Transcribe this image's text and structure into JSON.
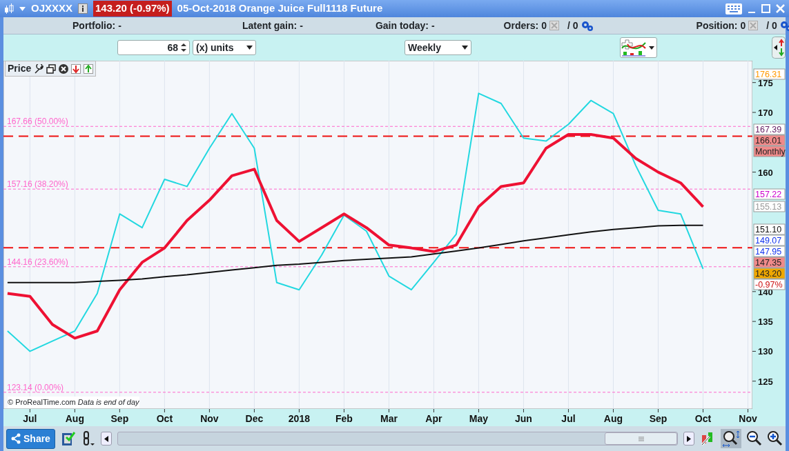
{
  "title_bar": {
    "instrument": "OJXXXX",
    "price_badge": "143.20 (-0.97%)",
    "description": "05-Oct-2018 Orange Juice Full1118 Future"
  },
  "info_bar": [
    {
      "kind": "plain",
      "label": "Portfolio:",
      "value": "-"
    },
    {
      "kind": "plain",
      "label": "Latent gain:",
      "value": "-"
    },
    {
      "kind": "plain",
      "label": "Gain today:",
      "value": "-"
    },
    {
      "kind": "counts",
      "label": "Orders:",
      "value": "0",
      "second": "/ 0"
    },
    {
      "kind": "counts",
      "label": "Position:",
      "value": "0",
      "second": "/ 0"
    }
  ],
  "toolbar": {
    "quantity": "68",
    "units": "(x) units",
    "period": "Weekly"
  },
  "panel": {
    "title": "Price"
  },
  "chart": {
    "chart_data": {
      "type": "line",
      "categories": [
        null,
        "Jul",
        null,
        "Aug",
        null,
        "Sep",
        null,
        "Oct",
        null,
        "Nov",
        null,
        "Dec",
        null,
        "2018",
        null,
        "Feb",
        null,
        "Mar",
        null,
        "Apr",
        null,
        "May",
        null,
        "Jun",
        null,
        "Jul",
        null,
        "Aug",
        null,
        "Sep",
        null,
        "Oct",
        null,
        "Nov",
        null
      ],
      "series": [
        {
          "color": "#22d8e0",
          "values": [
            133.4,
            130,
            131.7,
            133.4,
            139.7,
            153,
            150.7,
            158.8,
            157.6,
            164,
            169.8,
            164,
            141.5,
            140.3,
            146.1,
            152.8,
            150.1,
            142.6,
            140.3,
            144.9,
            149.6,
            173.2,
            171.5,
            165.7,
            165.2,
            168,
            172,
            169.8,
            161.1,
            153.6,
            153,
            143.8,
            null,
            null,
            null
          ]
        },
        {
          "color": "#ee1133",
          "values": [
            139.7,
            139.2,
            134.5,
            132.2,
            133.4,
            140.3,
            144.9,
            147.3,
            151.9,
            155.3,
            159.4,
            160.5,
            151.9,
            148.4,
            150.7,
            153,
            150.7,
            147.8,
            147.3,
            146.7,
            147.8,
            154.2,
            157.6,
            158.2,
            164,
            166.3,
            166.3,
            165.7,
            162.3,
            160,
            158.2,
            154.2,
            null,
            null,
            null
          ]
        },
        {
          "color": "#111111",
          "values": [
            141.5,
            141.5,
            141.5,
            141.5,
            141.7,
            141.9,
            142.1,
            142.5,
            142.8,
            143.2,
            143.6,
            144,
            144.4,
            144.6,
            144.9,
            145.2,
            145.4,
            145.6,
            145.8,
            146.3,
            146.8,
            147.3,
            147.9,
            148.5,
            149,
            149.5,
            150,
            150.4,
            150.7,
            151,
            151.1,
            151.1,
            null,
            null,
            null
          ]
        }
      ],
      "ylim": [
        120.35,
        178.66
      ],
      "yticks": [
        125,
        130,
        135,
        140,
        160,
        170,
        175
      ],
      "grid": true,
      "ref_lines": [
        {
          "axis": "y",
          "value": 167.66,
          "label": "167.66 (50.00%)",
          "color": "#ff66cc"
        },
        {
          "axis": "y",
          "value": 157.16,
          "label": "157.16 (38.20%)",
          "color": "#ff66cc"
        },
        {
          "axis": "y",
          "value": 144.16,
          "label": "144.16 (23.60%)",
          "color": "#ff66cc"
        },
        {
          "axis": "y",
          "value": 123.14,
          "label": "123.14 (0.00%)",
          "color": "#ff66cc"
        },
        {
          "axis": "y",
          "value": 166.01,
          "color": "#ee1111"
        },
        {
          "axis": "y",
          "value": 147.35,
          "color": "#ee1111"
        }
      ]
    },
    "price_tags": [
      {
        "text": "176.31",
        "color": "#ff9900",
        "filled": false
      },
      {
        "text": "167.39",
        "color": "#662266",
        "filled": false
      },
      {
        "text": "166.01",
        "color": "#f08a8a",
        "filled": true
      },
      {
        "text": "Monthly",
        "color": "#f08a8a",
        "filled": true
      },
      {
        "text": "157.22",
        "color": "#cc00cc",
        "filled": false
      },
      {
        "text": "155.13",
        "color": "#999999",
        "filled": false
      },
      {
        "text": "151.10",
        "color": "#111111",
        "filled": false
      },
      {
        "text": "149.07",
        "color": "#1133ee",
        "filled": false
      },
      {
        "text": "147.95",
        "color": "#1133ee",
        "filled": false
      },
      {
        "text": "147.35",
        "color": "#f08a8a",
        "filled": true
      },
      {
        "text": "143.20",
        "color": "#f0a800",
        "filled": true
      },
      {
        "text": "-0.97%",
        "color": "#cc1111",
        "filled": false
      }
    ],
    "credit": "© ProRealTime.com *Data is end of day*"
  },
  "bottom_bar": {
    "share": "Share"
  }
}
